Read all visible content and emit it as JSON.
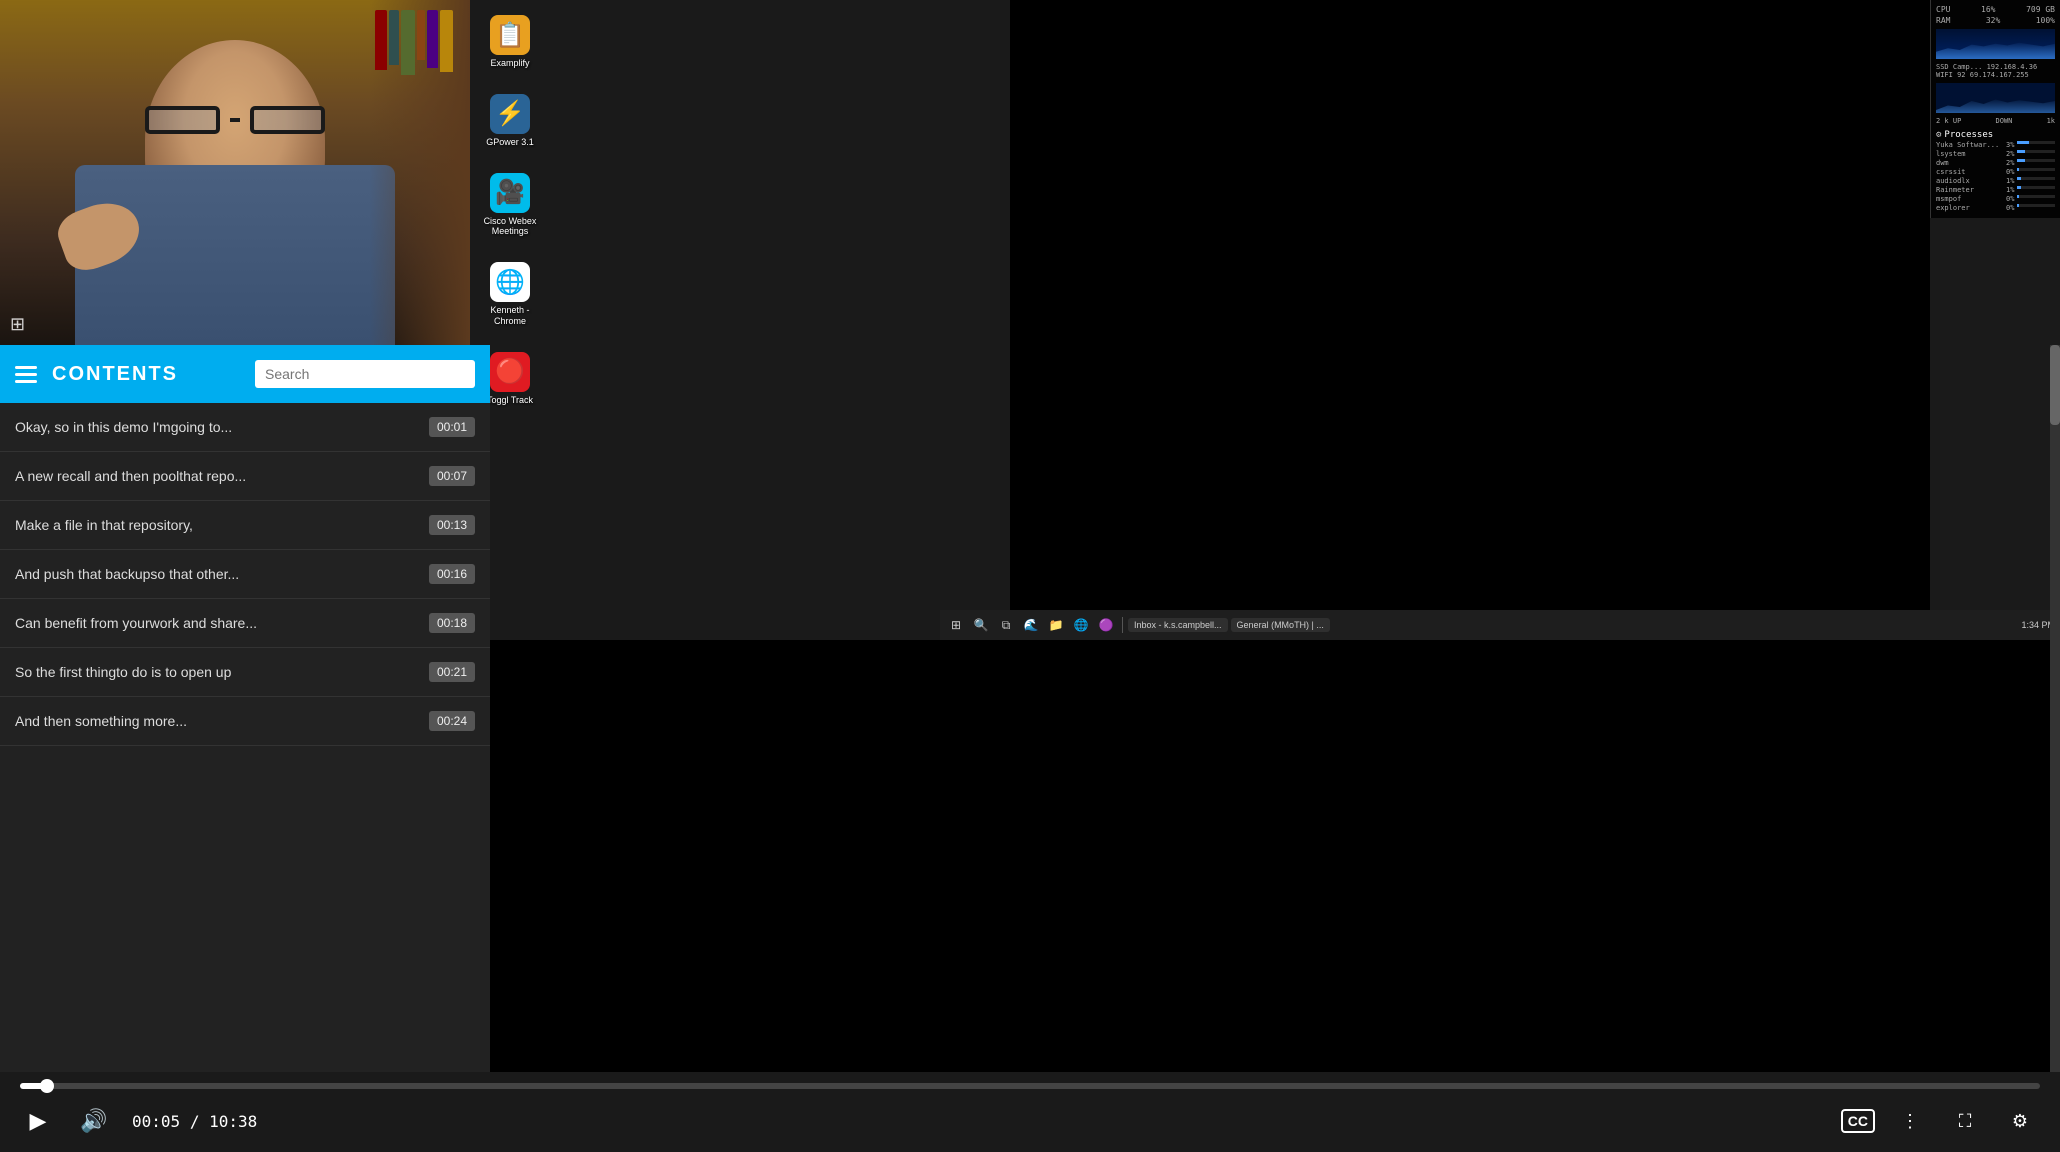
{
  "video": {
    "current_time": "00:05",
    "total_time": "10:38",
    "progress_percent": 0.8
  },
  "contents": {
    "title": "CONTENTS",
    "search_placeholder": "Search",
    "items": [
      {
        "text": "Okay, so in this demo I'mgoing to...",
        "time": "00:01"
      },
      {
        "text": "A new recall and then poolthat repo...",
        "time": "00:07"
      },
      {
        "text": "Make a file in that repository,",
        "time": "00:13"
      },
      {
        "text": "And push that backupso that other...",
        "time": "00:16"
      },
      {
        "text": "Can benefit from yourwork and share...",
        "time": "00:18"
      },
      {
        "text": "So the first thingto do is to open up",
        "time": "00:21"
      },
      {
        "text": "And then something more...",
        "time": "00:24"
      }
    ]
  },
  "desktop_icons": [
    {
      "label": "Examplify",
      "icon": "📋"
    },
    {
      "label": "GPower 3.1",
      "icon": "⚡"
    },
    {
      "label": "Cisco Webex Meetings",
      "icon": "🎥"
    },
    {
      "label": "Kenneth - Chrome",
      "icon": "🌐"
    },
    {
      "label": "Toggl Track",
      "icon": "🔴"
    }
  ],
  "system_monitor": {
    "cpu_label": "CPU",
    "cpu_value": "16%",
    "ram_label": "RAM",
    "ram_value": "32%",
    "storage_label": "709 GB",
    "storage_value": "100%",
    "ssd_label": "SSD",
    "wifi_label": "WIFI",
    "wifi_value": "92",
    "processes_label": "Processes",
    "processes": [
      {
        "name": "Yuka Softwar...",
        "value": "3%",
        "bar": 30
      },
      {
        "name": "lsystem",
        "value": "2%",
        "bar": 20
      },
      {
        "name": "dwm",
        "value": "2%",
        "bar": 20
      },
      {
        "name": "csrssit",
        "value": "0%",
        "bar": 5
      },
      {
        "name": "audiodlx",
        "value": "1%",
        "bar": 10
      },
      {
        "name": "Rainmeter",
        "value": "1%",
        "bar": 10
      },
      {
        "name": "msmpof",
        "value": "0%",
        "bar": 5
      },
      {
        "name": "explorer",
        "value": "0%",
        "bar": 3
      }
    ]
  },
  "taskbar": {
    "time": "1:34 PM",
    "buttons": [
      "Inbox - k.s.campbell...",
      "General (MMoTH) | ..."
    ]
  },
  "controls": {
    "play_label": "▶",
    "volume_label": "🔊",
    "cc_label": "CC",
    "chapters_label": "⋮",
    "fullscreen_label": "⛶",
    "settings_label": "⚙"
  }
}
